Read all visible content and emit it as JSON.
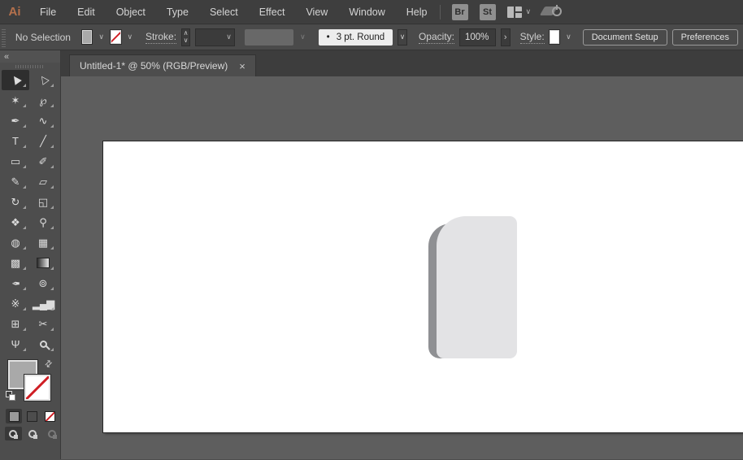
{
  "app": {
    "logo": "Ai"
  },
  "menubar": {
    "menus": [
      "File",
      "Edit",
      "Object",
      "Type",
      "Select",
      "Effect",
      "View",
      "Window",
      "Help"
    ],
    "bridge_badge": "Br",
    "stock_badge": "St"
  },
  "control_bar": {
    "selection_status": "No Selection",
    "stroke_label": "Stroke:",
    "brush_bullet": "•",
    "brush_value": "3 pt. Round",
    "opacity_label": "Opacity:",
    "opacity_value": "100%",
    "style_label": "Style:",
    "document_setup_button": "Document Setup",
    "preferences_button": "Preferences"
  },
  "tab": {
    "title": "Untitled-1* @ 50% (RGB/Preview)",
    "close": "×"
  },
  "toolbar": {
    "collapse": "«",
    "tools": [
      {
        "name": "selection",
        "glyph": "▶",
        "cls": "r-up",
        "selected": true
      },
      {
        "name": "direct-selection",
        "glyph": "▷",
        "cls": "r-up"
      },
      {
        "name": "magic-wand",
        "glyph": "✶"
      },
      {
        "name": "lasso",
        "glyph": "℘"
      },
      {
        "name": "pen",
        "glyph": "✒"
      },
      {
        "name": "curvature",
        "glyph": "∿"
      },
      {
        "name": "type",
        "glyph": "T"
      },
      {
        "name": "line-segment",
        "glyph": "╱"
      },
      {
        "name": "rectangle",
        "glyph": "▭"
      },
      {
        "name": "paintbrush",
        "glyph": "✐"
      },
      {
        "name": "shaper",
        "glyph": "✎"
      },
      {
        "name": "eraser",
        "glyph": "▱"
      },
      {
        "name": "rotate",
        "glyph": "↻"
      },
      {
        "name": "scale",
        "glyph": "◱"
      },
      {
        "name": "width",
        "glyph": "❖"
      },
      {
        "name": "puppet-warp",
        "glyph": "⚲"
      },
      {
        "name": "shape-builder",
        "glyph": "◍"
      },
      {
        "name": "perspective-grid",
        "glyph": "▦"
      },
      {
        "name": "mesh",
        "glyph": "▩"
      },
      {
        "name": "gradient",
        "glyph": "",
        "cls": "grad-g"
      },
      {
        "name": "eyedropper",
        "glyph": "✒",
        "cls": "rot180"
      },
      {
        "name": "blend",
        "glyph": "⊚"
      },
      {
        "name": "symbol-sprayer",
        "glyph": "※"
      },
      {
        "name": "column-graph",
        "glyph": "▂▄▆",
        "cls": "bars"
      },
      {
        "name": "artboard",
        "glyph": "⊞"
      },
      {
        "name": "slice",
        "glyph": "✂"
      },
      {
        "name": "hand",
        "glyph": "Ψ"
      },
      {
        "name": "zoom",
        "glyph": "",
        "cls": "zoomglass"
      }
    ],
    "paint_buttons": [
      {
        "name": "color",
        "selected": true
      },
      {
        "name": "gradient"
      },
      {
        "name": "none"
      }
    ],
    "draw_modes": [
      {
        "name": "draw-normal",
        "selected": true
      },
      {
        "name": "draw-behind"
      },
      {
        "name": "draw-inside",
        "disabled": true
      }
    ]
  },
  "icons": {
    "chevron_down": "∨",
    "stepper_up": "∧",
    "stepper_down": "∨",
    "arrow_right": "›",
    "swap": "⇄"
  },
  "colors": {
    "accent_orange": "#b5714c",
    "menubar_bg": "#3e3e3e",
    "panel_bg": "#4d4d4d",
    "canvas_bg": "#5e5e5e",
    "artboard": "#ffffff",
    "shape_light": "#e3e3e5",
    "shape_shadow": "#8f9093",
    "none_red": "#cf1f25"
  }
}
